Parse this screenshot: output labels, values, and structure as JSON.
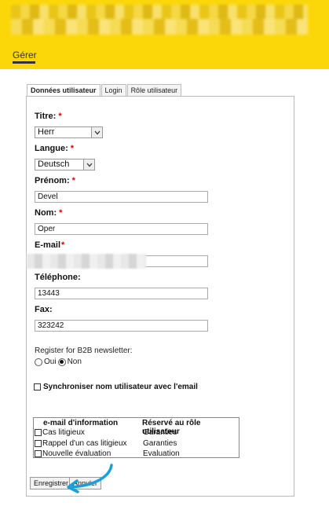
{
  "header": {
    "nav_label": "Gérer"
  },
  "tabs": [
    {
      "label": "Données utilisateur"
    },
    {
      "label": "Login"
    },
    {
      "label": "Rôle utilisateur"
    }
  ],
  "form": {
    "title_label": "Titre:",
    "title_value": "Herr",
    "language_label": "Langue:",
    "language_value": "Deutsch",
    "firstname_label": "Prénom:",
    "firstname_value": "Devel",
    "lastname_label": "Nom:",
    "lastname_value": "Oper",
    "email_label": "E-mail",
    "email_value": "",
    "phone_label": "Téléphone:",
    "phone_value": "13443",
    "fax_label": "Fax:",
    "fax_value": "323242",
    "required_mark": "*",
    "newsletter_label": "Register for B2B newsletter:",
    "newsletter_yes": "Oui",
    "newsletter_no": "Non",
    "newsletter_selected": "Non",
    "sync_label": "Synchroniser nom utilisateur avec l'email"
  },
  "info_table": {
    "headers": [
      "e-mail d'information",
      "Réservé au rôle utilisateur"
    ],
    "rows": [
      {
        "name": "Cas litigieux",
        "role": "Garanties"
      },
      {
        "name": "Rappel d'un cas litigieux",
        "role": "Garanties"
      },
      {
        "name": "Nouvelle évaluation",
        "role": "Evaluation"
      }
    ]
  },
  "buttons": {
    "save": "Enregistrer",
    "cancel": "Annuler"
  },
  "colors": {
    "header_bg": "#fbd70a",
    "required": "#dd0000",
    "annotation_arrow": "#1aa0d8"
  }
}
